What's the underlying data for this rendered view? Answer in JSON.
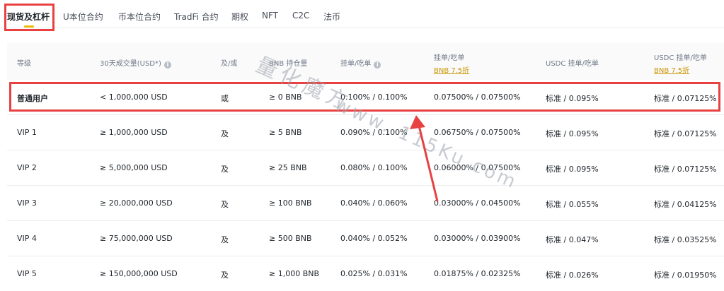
{
  "tabs": [
    {
      "label": "现货及杠杆",
      "active": true
    },
    {
      "label": "U本位合约",
      "active": false
    },
    {
      "label": "币本位合约",
      "active": false
    },
    {
      "label": "TradFi 合约",
      "active": false
    },
    {
      "label": "期权",
      "active": false
    },
    {
      "label": "NFT",
      "active": false
    },
    {
      "label": "C2C",
      "active": false
    },
    {
      "label": "法币",
      "active": false
    }
  ],
  "table": {
    "headers": {
      "level": "等级",
      "volume": "30天成交量(USD*)",
      "andor": "及/或",
      "bnb": "BNB 持仓量",
      "maker_taker": "挂单/吃单",
      "bnb_discount": "挂单/吃单",
      "bnb_discount_link": "BNB 7.5折",
      "usdc": "USDC 挂单/吃单",
      "usdc_discount": "USDC 挂单/吃单",
      "usdc_discount_link": "BNB 7.5折"
    },
    "rows": [
      {
        "level": "普通用户",
        "volume": "< 1,000,000 USD",
        "andor": "或",
        "bnb": "≥ 0 BNB",
        "maker_taker": "0.100% / 0.100%",
        "bnb_discount": "0.07500% / 0.07500%",
        "usdc": "标准 / 0.095%",
        "usdc_discount": "标准 / 0.07125%"
      },
      {
        "level": "VIP 1",
        "volume": "≥ 1,000,000 USD",
        "andor": "及",
        "bnb": "≥ 5 BNB",
        "maker_taker": "0.090% / 0.100%",
        "bnb_discount": "0.06750% / 0.07500%",
        "usdc": "标准 / 0.095%",
        "usdc_discount": "标准 / 0.07125%"
      },
      {
        "level": "VIP 2",
        "volume": "≥ 5,000,000 USD",
        "andor": "及",
        "bnb": "≥ 25 BNB",
        "maker_taker": "0.080% / 0.100%",
        "bnb_discount": "0.06000% / 0.07500%",
        "usdc": "标准 / 0.095%",
        "usdc_discount": "标准 / 0.07125%"
      },
      {
        "level": "VIP 3",
        "volume": "≥ 20,000,000 USD",
        "andor": "及",
        "bnb": "≥ 100 BNB",
        "maker_taker": "0.040% / 0.060%",
        "bnb_discount": "0.03000% / 0.04500%",
        "usdc": "标准 / 0.055%",
        "usdc_discount": "标准 / 0.04125%"
      },
      {
        "level": "VIP 4",
        "volume": "≥ 75,000,000 USD",
        "andor": "及",
        "bnb": "≥ 500 BNB",
        "maker_taker": "0.040% / 0.052%",
        "bnb_discount": "0.03000% / 0.03900%",
        "usdc": "标准 / 0.047%",
        "usdc_discount": "标准 / 0.03525%"
      },
      {
        "level": "VIP 5",
        "volume": "≥ 150,000,000 USD",
        "andor": "及",
        "bnb": "≥ 1,000 BNB",
        "maker_taker": "0.025% / 0.031%",
        "bnb_discount": "0.01875% / 0.02325%",
        "usdc": "标准 / 0.026%",
        "usdc_discount": "标准 / 0.01950%"
      }
    ]
  },
  "watermark": {
    "text_cn": "量化魔方",
    "text_url": "www. 115Ku.com"
  },
  "colors": {
    "accent": "#f0b90b",
    "highlight": "#e84142",
    "link": "#c99400"
  }
}
